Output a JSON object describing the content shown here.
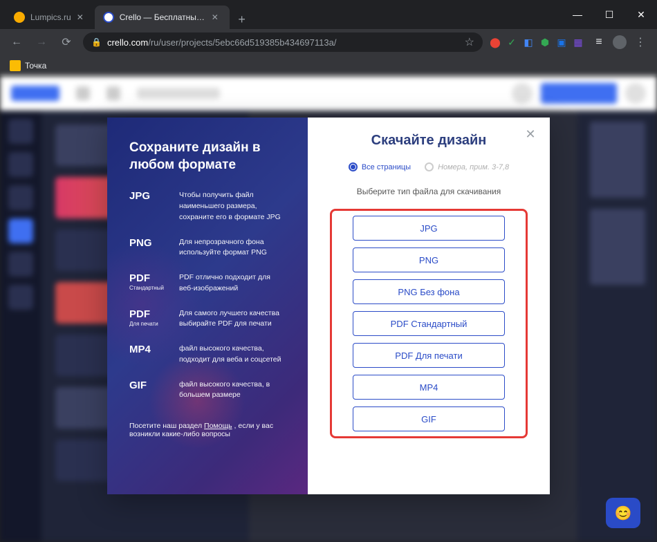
{
  "window": {
    "tabs": [
      {
        "title": "Lumpics.ru",
        "active": false,
        "favicon_color": "#f9ab00"
      },
      {
        "title": "Crello — Бесплатный инструмен",
        "active": true,
        "favicon_color": "#2a4bc7"
      }
    ],
    "url_domain": "crello.com",
    "url_path": "/ru/user/projects/5ebc66d519385b434697113a/"
  },
  "bookmarks": {
    "item1": "Точка"
  },
  "modal": {
    "left_title": "Сохраните дизайн в любом формате",
    "formats": [
      {
        "name": "JPG",
        "sub": "",
        "desc": "Чтобы получить файл наименьшего размера, сохраните его в формате JPG"
      },
      {
        "name": "PNG",
        "sub": "",
        "desc": "Для непрозрачного фона используйте формат PNG"
      },
      {
        "name": "PDF",
        "sub": "Стандартный",
        "desc": "PDF отлично подходит для веб-изображений"
      },
      {
        "name": "PDF",
        "sub": "Для печати",
        "desc": "Для самого лучшего качества выбирайте PDF для печати"
      },
      {
        "name": "MP4",
        "sub": "",
        "desc": "файл высокого качества, подходит для веба и соцсетей"
      },
      {
        "name": "GIF",
        "sub": "",
        "desc": "файл высокого качества, в большем размере"
      }
    ],
    "help_prefix": "Посетите наш раздел ",
    "help_link": "Помощь",
    "help_suffix": " , если у вас возникли какие-либо вопросы",
    "right_title": "Скачайте дизайн",
    "radio_all": "Все страницы",
    "radio_numbers": "Номера, прим. 3-7,8",
    "subtitle": "Выберите тип файла для скачивания",
    "buttons": [
      "JPG",
      "PNG",
      "PNG Без фона",
      "PDF Стандартный",
      "PDF Для печати",
      "MP4",
      "GIF"
    ]
  }
}
